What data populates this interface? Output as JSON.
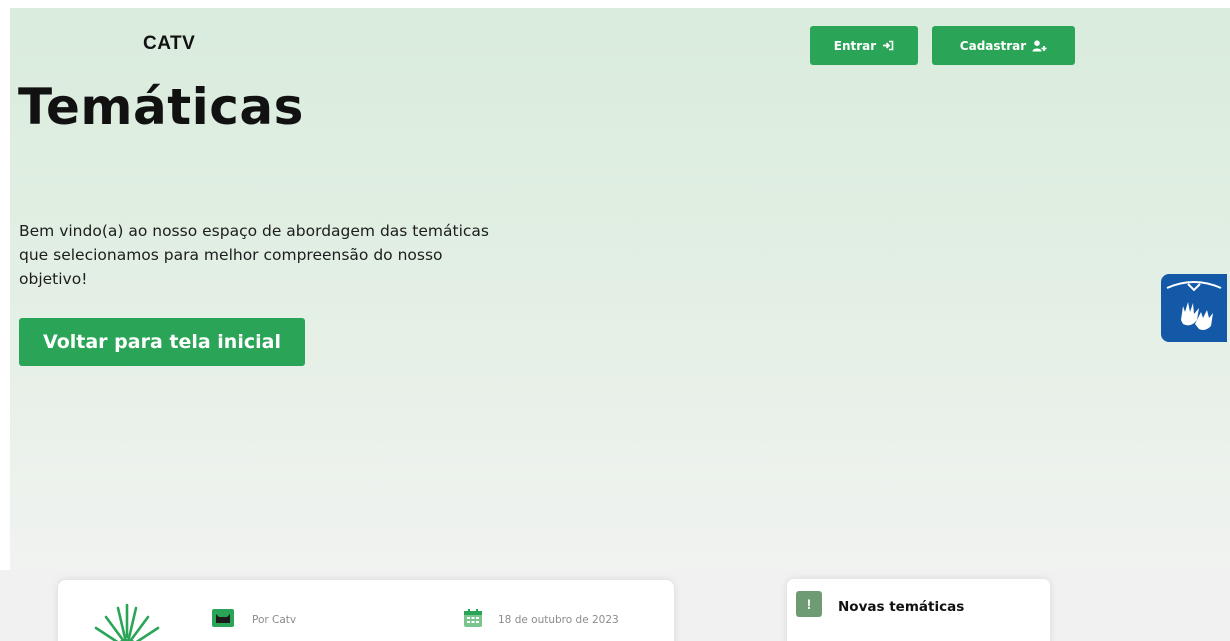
{
  "header": {
    "brand": "CATV",
    "login_label": "Entrar",
    "register_label": "Cadastrar"
  },
  "hero": {
    "title": "Temáticas",
    "intro": "Bem vindo(a) ao nosso espaço de abordagem das temáticas que selecionamos para melhor compreensão do nosso objetivo!",
    "back_button_label": "Voltar para tela inicial"
  },
  "post": {
    "author": "Por Catv",
    "date": "18 de outubro de 2023"
  },
  "sidebar": {
    "badge": "!",
    "title": "Novas temáticas"
  },
  "colors": {
    "accent": "#2aa557",
    "accessibility_blue": "#1359a8",
    "badge_green": "#6f9b72"
  },
  "icons": {
    "login": "sign-in-icon",
    "register": "user-plus-icon",
    "accessibility": "sign-language-icon",
    "author": "cat-icon",
    "date": "calendar-icon",
    "thumbnail": "sun-icon"
  }
}
